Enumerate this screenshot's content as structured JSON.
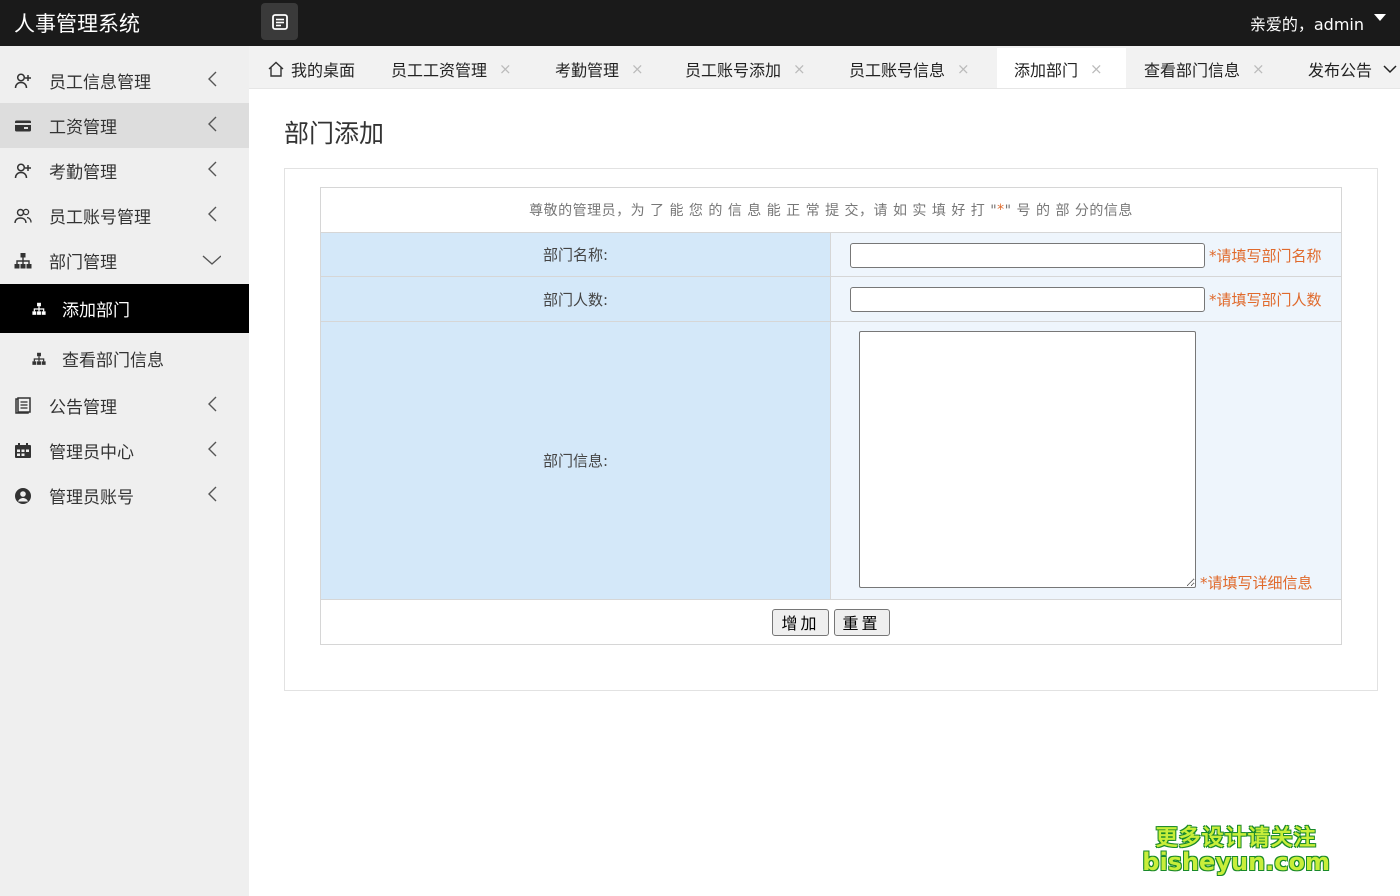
{
  "header": {
    "app_title": "人事管理系统",
    "user_greeting": "亲爱的，admin"
  },
  "sidebar": {
    "items": [
      {
        "label": "员工信息管理",
        "icon": "user-plus-icon"
      },
      {
        "label": "工资管理",
        "icon": "card-icon"
      },
      {
        "label": "考勤管理",
        "icon": "user-plus-icon"
      },
      {
        "label": "员工账号管理",
        "icon": "users-icon"
      },
      {
        "label": "部门管理",
        "icon": "sitemap-icon"
      },
      {
        "label": "公告管理",
        "icon": "document-icon"
      },
      {
        "label": "管理员中心",
        "icon": "calendar-icon"
      },
      {
        "label": "管理员账号",
        "icon": "user-circle-icon"
      }
    ],
    "sub_items": [
      {
        "label": "添加部门",
        "icon": "sitemap-icon"
      },
      {
        "label": "查看部门信息",
        "icon": "sitemap-icon"
      }
    ]
  },
  "tabs": [
    {
      "label": "我的桌面",
      "icon": "home-icon"
    },
    {
      "label": "员工工资管理",
      "close": "×"
    },
    {
      "label": "考勤管理",
      "close": "×"
    },
    {
      "label": "员工账号添加",
      "close": "×"
    },
    {
      "label": "员工账号信息",
      "close": "×"
    },
    {
      "label": "添加部门",
      "close": "×"
    },
    {
      "label": "查看部门信息",
      "close": "×"
    },
    {
      "label": "发布公告"
    }
  ],
  "page": {
    "title": "部门添加",
    "notice_before": "尊敬的管理员，为 了 能 您 的 信 息 能 正 常 提 交，请 如 实 填 好 打 \"",
    "notice_star": "*",
    "notice_after": "\" 号 的 部 分的信息",
    "fields": {
      "name_label": "部门名称:",
      "name_hint": "*请填写部门名称",
      "count_label": "部门人数:",
      "count_hint": "*请填写部门人数",
      "info_label": "部门信息:",
      "info_hint": "*请填写详细信息"
    },
    "buttons": {
      "add": "增加",
      "reset": "重置"
    }
  },
  "watermark": {
    "line1": "更多设计请关注",
    "line2": "bisheyun.com"
  },
  "colors": {
    "header_bg": "#1a1a1a",
    "sidebar_bg": "#efefef",
    "label_cell_bg": "#d4e8f9",
    "input_cell_bg": "#eef5fc",
    "hint_color": "#e06a2c"
  }
}
